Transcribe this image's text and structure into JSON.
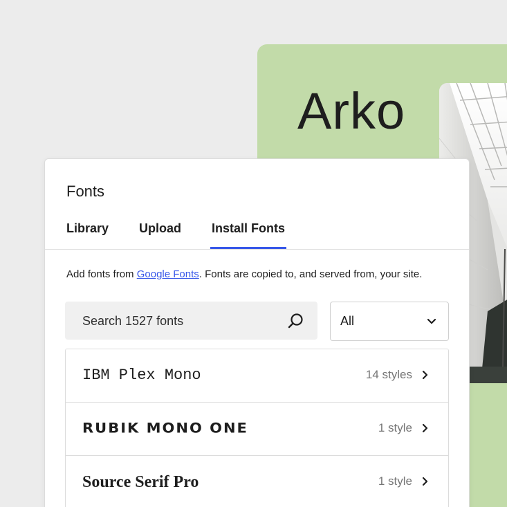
{
  "preview": {
    "title": "Arko"
  },
  "panel": {
    "title": "Fonts",
    "tabs": [
      {
        "label": "Library",
        "active": false
      },
      {
        "label": "Upload",
        "active": false
      },
      {
        "label": "Install Fonts",
        "active": true
      }
    ],
    "description_prefix": "Add fonts from ",
    "description_link": "Google Fonts",
    "description_suffix": ". Fonts are copied to, and served from, your site.",
    "search_placeholder": "Search 1527 fonts",
    "filter_selected": "All",
    "fonts": [
      {
        "name": "IBM Plex Mono",
        "styles": "14 styles"
      },
      {
        "name": "RUBIK MONO ONE",
        "styles": "1 style"
      },
      {
        "name": "Source Serif Pro",
        "styles": "1 style"
      }
    ]
  },
  "colors": {
    "accent": "#3858e9",
    "preview_background": "#c2dba9",
    "page_background": "#ececec"
  },
  "icons": {
    "search": "search-icon",
    "select_chevron": "chevron-down-icon",
    "row_chevron": "chevron-right-icon"
  }
}
